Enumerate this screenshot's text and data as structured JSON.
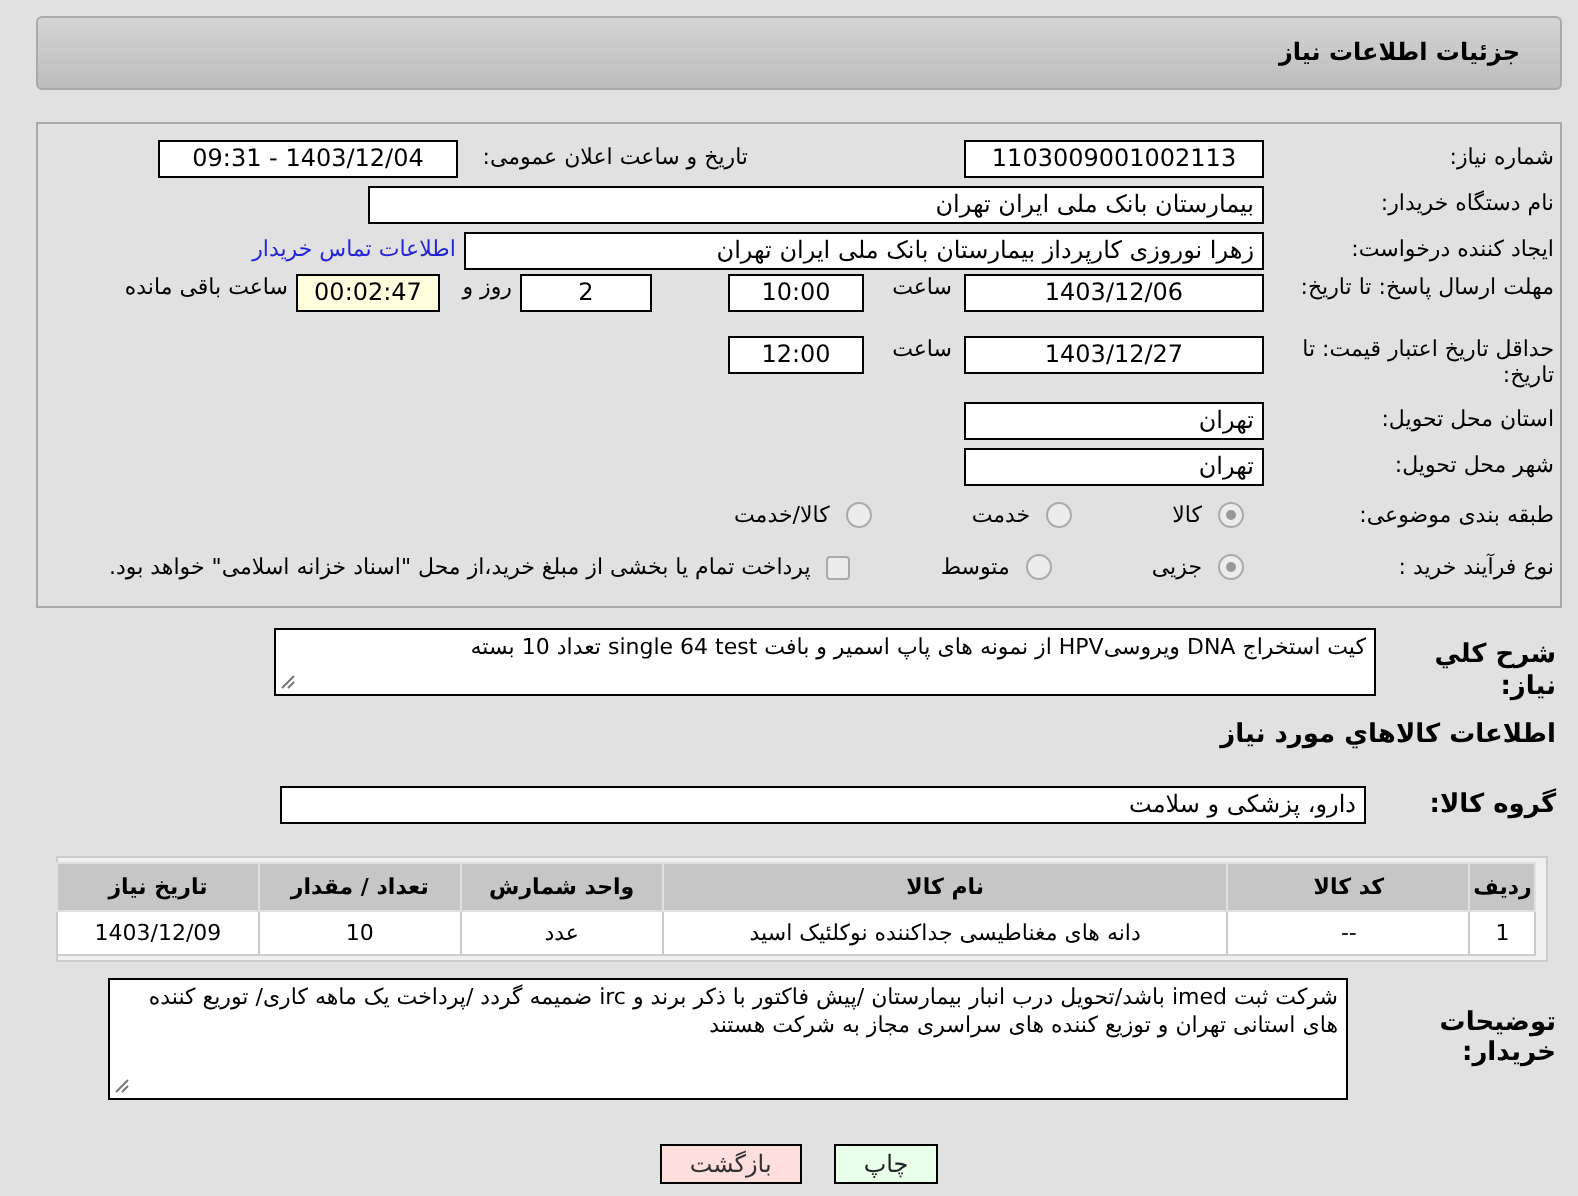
{
  "header": {
    "title": "جزئیات اطلاعات نیاز"
  },
  "need_number": {
    "label": "شماره نیاز:",
    "value": "1103009001002113"
  },
  "announce": {
    "label": "تاریخ و ساعت اعلان عمومی:",
    "value": "1403/12/04 - 09:31"
  },
  "buyer_org": {
    "label": "نام دستگاه خریدار:",
    "value": "بیمارستان بانک ملی ایران تهران"
  },
  "requester": {
    "label": "ایجاد کننده درخواست:",
    "value": "زهرا نوروزی کارپرداز بیمارستان بانک ملی ایران تهران",
    "link": "اطلاعات تماس خریدار"
  },
  "reply_deadline": {
    "label": "مهلت ارسال پاسخ: تا تاریخ:",
    "date": "1403/12/06",
    "time_label": "ساعت",
    "time": "10:00",
    "days": "2",
    "days_label": "روز و",
    "remaining": "00:02:47",
    "remaining_label": "ساعت باقی مانده"
  },
  "price_validity": {
    "label": "حداقل تاریخ اعتبار قیمت: تا تاریخ:",
    "date": "1403/12/27",
    "time_label": "ساعت",
    "time": "12:00"
  },
  "province": {
    "label": "استان محل تحویل:",
    "value": "تهران"
  },
  "city": {
    "label": "شهر محل تحویل:",
    "value": "تهران"
  },
  "category": {
    "label": "طبقه بندی موضوعی:",
    "options": [
      {
        "label": "کالا",
        "selected": true
      },
      {
        "label": "خدمت",
        "selected": false
      },
      {
        "label": "کالا/خدمت",
        "selected": false
      }
    ]
  },
  "process": {
    "label": "نوع فرآیند خرید :",
    "options": [
      {
        "label": "جزیی",
        "selected": true
      },
      {
        "label": "متوسط",
        "selected": false
      }
    ],
    "payment": {
      "label": "پرداخت تمام یا بخشی از مبلغ خرید،از محل \"اسناد خزانه اسلامی\" خواهد بود.",
      "checked": false
    }
  },
  "description": {
    "label": "شرح کلي نياز:",
    "value": "کیت استخراج DNA ویروسیHPV از نمونه های پاپ اسمیر و بافت  single 64 test تعداد 10 بسته"
  },
  "items_title": "اطلاعات کالاهاي مورد نياز",
  "goods_group": {
    "label": "گروه کالا:",
    "value": "دارو، پزشکی و سلامت"
  },
  "table": {
    "columns": [
      "ردیف",
      "کد کالا",
      "نام کالا",
      "واحد شمارش",
      "تعداد / مقدار",
      "تاریخ نیاز"
    ],
    "rows": [
      [
        "1",
        "--",
        "دانه های مغناطیسی جداکننده نوکلئیک اسید",
        "عدد",
        "10",
        "1403/12/09"
      ]
    ]
  },
  "buyer_notes": {
    "label": "توضیحات خریدار:",
    "value": "شرکت ثبت imed باشد/تحویل درب انبار بیمارستان /پیش فاکتور با ذکر برند و irc ضمیمه گردد /پرداخت یک ماهه کاری/ توریع کننده های استانی تهران و توزیع کننده های سراسری مجاز به شرکت هستند"
  },
  "buttons": [
    {
      "label": "چاپ",
      "kind": "print"
    },
    {
      "label": "بازگشت",
      "kind": "back"
    }
  ]
}
